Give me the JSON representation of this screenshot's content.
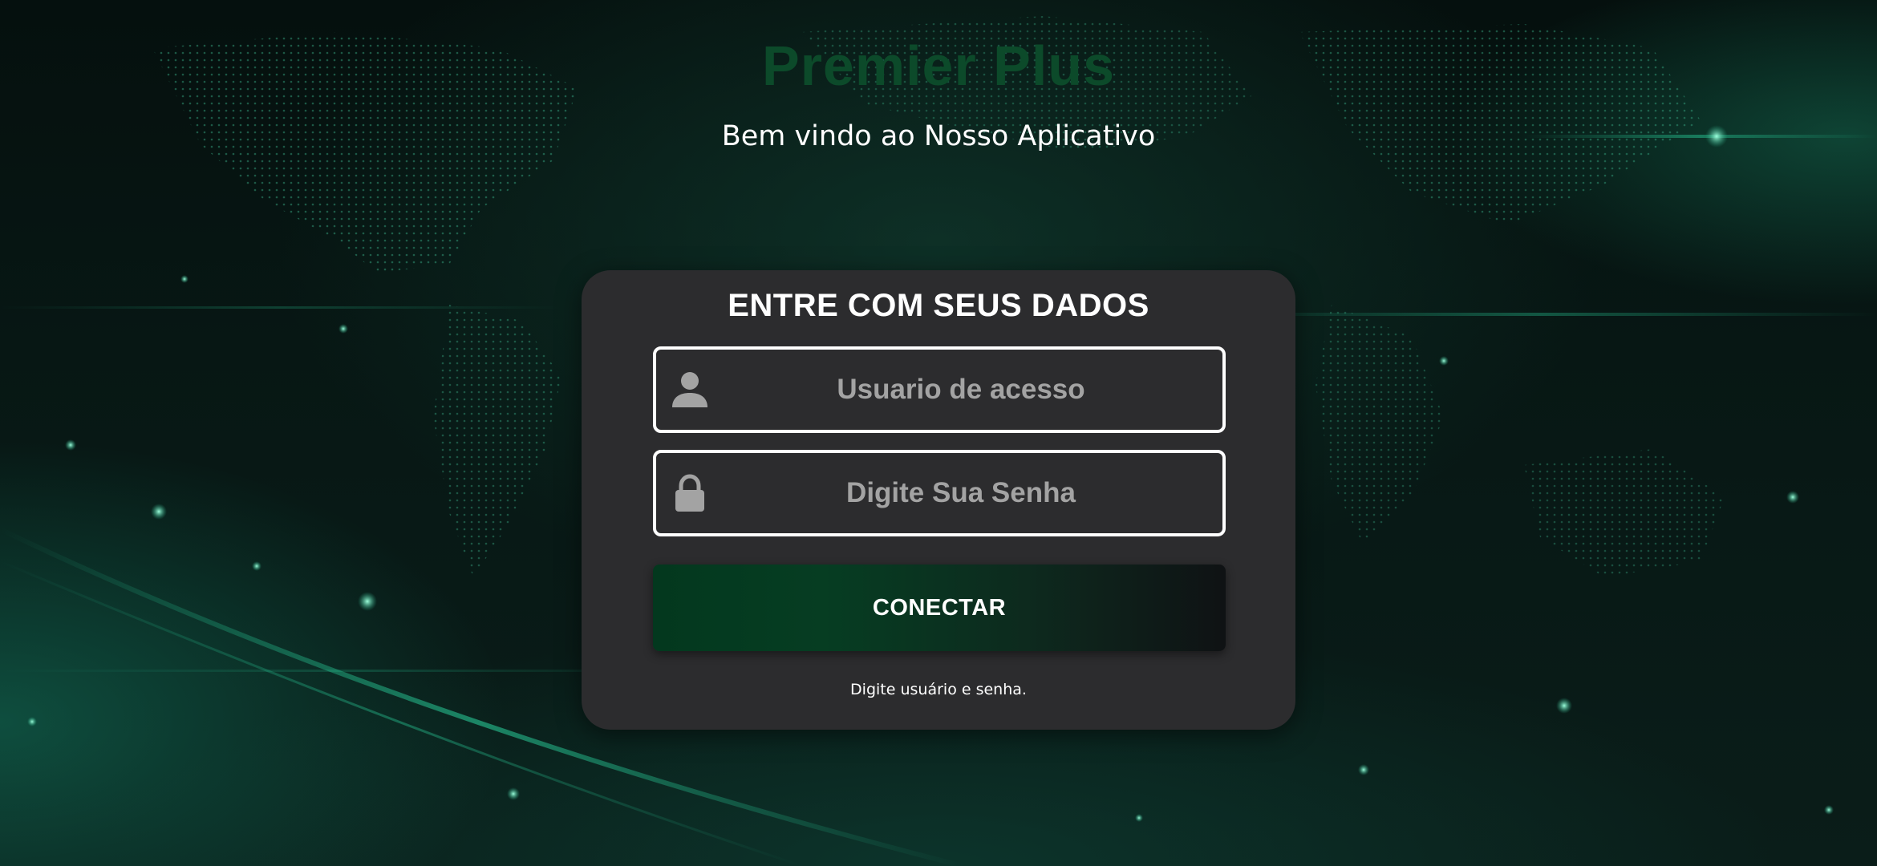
{
  "app": {
    "brand_title": "Premier Plus",
    "welcome_text": "Bem vindo ao Nosso Aplicativo"
  },
  "login_card": {
    "title": "ENTRE COM SEUS DADOS",
    "username": {
      "value": "",
      "placeholder": "Usuario de acesso",
      "icon": "person-icon"
    },
    "password": {
      "value": "",
      "placeholder": "Digite Sua Senha",
      "icon": "lock-icon"
    },
    "connect_label": "CONECTAR",
    "hint_text": "Digite usuário e senha."
  },
  "colors": {
    "brand_title": "#0c4a2a",
    "card_background": "#2c2c2e",
    "button_gradient_start": "#03381e",
    "button_gradient_end": "#0f1214",
    "placeholder_text": "#a3a3a3",
    "accent_glow": "#1fa07a"
  }
}
